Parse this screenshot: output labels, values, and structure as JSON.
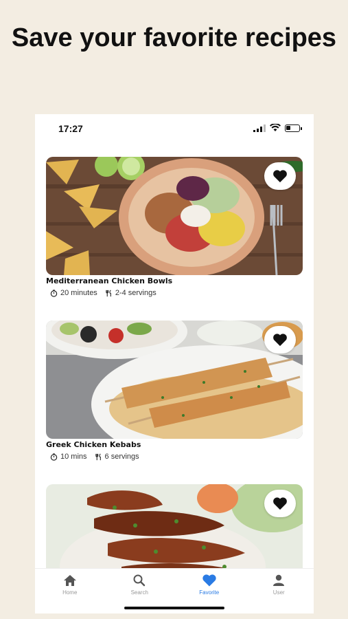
{
  "headline": "Save your favorite recipes",
  "status_bar": {
    "time": "17:27"
  },
  "recipes": [
    {
      "title": "Mediterranean Chicken Bowls",
      "time": "20 minutes",
      "servings": "2-4 servings",
      "favorited": true
    },
    {
      "title": "Greek Chicken Kebabs",
      "time": "10 mins",
      "servings": "6 servings",
      "favorited": true
    },
    {
      "title": "",
      "time": "",
      "servings": "",
      "favorited": true
    }
  ],
  "tabs": [
    {
      "label": "Home",
      "icon": "home-icon"
    },
    {
      "label": "Search",
      "icon": "search-icon"
    },
    {
      "label": "Favorite",
      "icon": "heart-icon",
      "active": true
    },
    {
      "label": "User",
      "icon": "user-icon"
    }
  ],
  "colors": {
    "background": "#f3ede2",
    "accent": "#2a7be4"
  }
}
